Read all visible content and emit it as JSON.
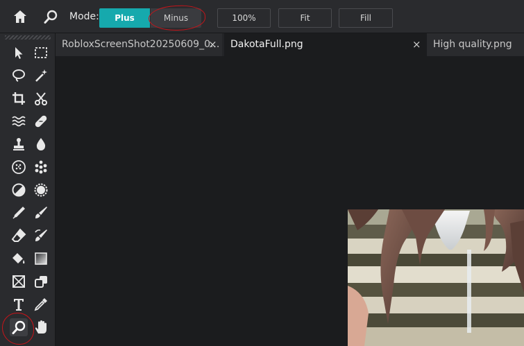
{
  "toolbar": {
    "mode_label": "Mode:",
    "plus_label": "Plus",
    "minus_label": "Minus",
    "zoom_100_label": "100%",
    "fit_label": "Fit",
    "fill_label": "Fill",
    "accent_color": "#16a9ad",
    "annotation_color": "#c8141a"
  },
  "tabs": [
    {
      "label": "RobloxScreenShot20250609_0...",
      "close": "×"
    },
    {
      "label": "DakotaFull.png",
      "close": "×",
      "active": true
    },
    {
      "label": "High quality.png"
    }
  ],
  "tools": [
    "move-icon",
    "marquee-select-icon",
    "lasso-icon",
    "magic-wand-icon",
    "crop-icon",
    "scissors-icon",
    "liquify-icon",
    "healing-bandage-icon",
    "clone-stamp-icon",
    "blur-drop-icon",
    "sponge-icon",
    "pattern-dots-icon",
    "dodge-burn-icon",
    "sharpen-gear-icon",
    "pencil-icon",
    "brush-icon",
    "eraser-icon",
    "color-replace-icon",
    "paint-bucket-icon",
    "gradient-icon",
    "shape-icon",
    "layer-shape-icon",
    "text-icon",
    "eyedropper-icon",
    "zoom-tool-icon",
    "hand-icon"
  ]
}
